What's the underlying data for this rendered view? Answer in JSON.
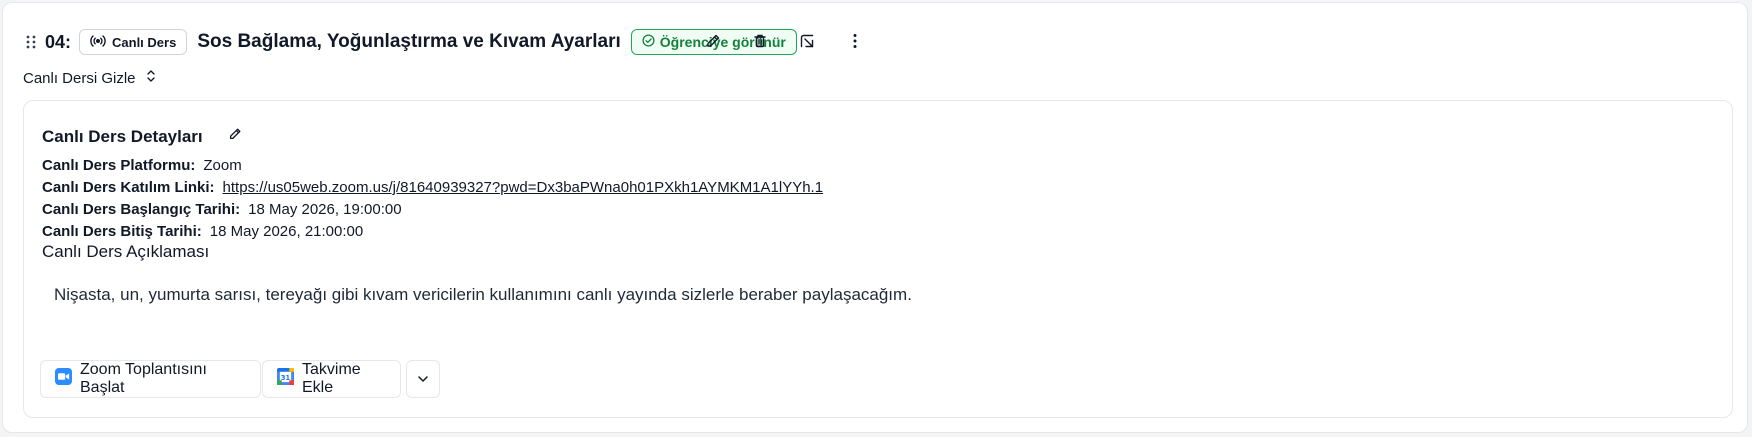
{
  "header": {
    "number": "04:",
    "live_chip_label": "Canlı Ders",
    "title": "Sos Bağlama, Yoğunlaştırma ve Kıvam Ayarları",
    "visibility_badge": "Öğrenciye görünür"
  },
  "toggle": {
    "label": "Canlı Dersi Gizle"
  },
  "details": {
    "title": "Canlı Ders Detayları",
    "platform_label": "Canlı Ders Platformu:",
    "platform_value": "Zoom",
    "link_label": "Canlı Ders Katılım Linki:",
    "link_value": "https://us05web.zoom.us/j/81640939327?pwd=Dx3baPWna0h01PXkh1AYMKM1A1lYYh.1",
    "start_label": "Canlı Ders Başlangıç Tarihi:",
    "start_value": "18 May 2026, 19:00:00",
    "end_label": "Canlı Ders Bitiş Tarihi:",
    "end_value": "18 May 2026, 21:00:00",
    "description_title": "Canlı Ders Açıklaması",
    "description_text": "Nişasta, un, yumurta sarısı, tereyağı gibi kıvam vericilerin kullanımını canlı yayında sizlerle beraber paylaşacağım."
  },
  "actions": {
    "zoom_start": "Zoom Toplantısını Başlat",
    "calendar_add": "Takvime Ekle"
  },
  "colors": {
    "badge_green": "#15803d",
    "zoom_blue": "#2D8CFF"
  }
}
